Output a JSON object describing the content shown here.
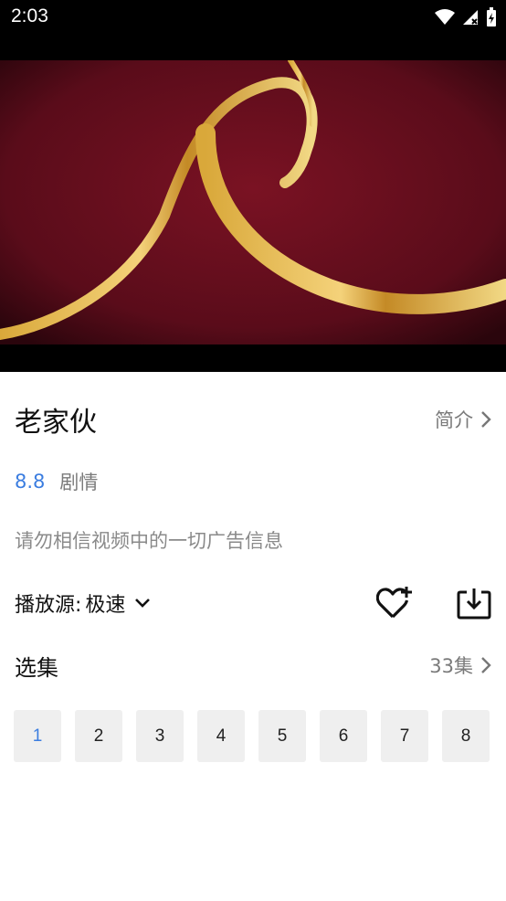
{
  "status_bar": {
    "time": "2:03"
  },
  "video": {},
  "title": "老家伙",
  "intro_label": "简介",
  "rating": "8.8",
  "genre": "剧情",
  "notice": "请勿相信视频中的一切广告信息",
  "source": {
    "label": "播放源:",
    "value": "极速"
  },
  "episodes": {
    "title": "选集",
    "count": "33集",
    "items": [
      "1",
      "2",
      "3",
      "4",
      "5",
      "6",
      "7",
      "8"
    ],
    "active": "1"
  },
  "colors": {
    "accent": "#3b7de0",
    "video_background": "#6b0f1f",
    "ribbon": "#e8c260"
  }
}
